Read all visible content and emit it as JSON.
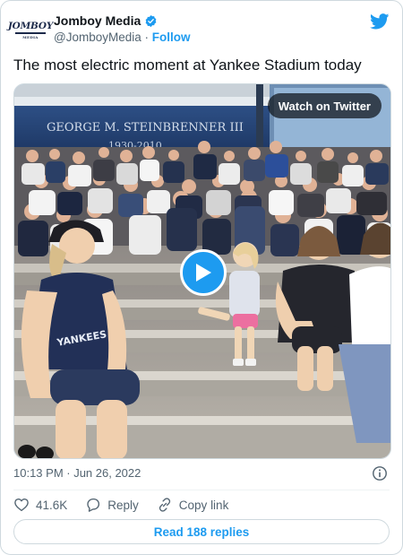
{
  "author": {
    "display_name": "Jomboy Media",
    "handle": "@JomboyMedia",
    "separator": " · ",
    "follow_label": "Follow",
    "logo_text": "JOMBOY",
    "logo_subtext": "MEDIA",
    "verified_icon": "verified-badge-icon"
  },
  "tweet": {
    "text": "The most electric moment at Yankee Stadium today",
    "timestamp": "10:13 PM · Jun 26, 2022"
  },
  "media": {
    "type": "video",
    "watch_label": "Watch on Twitter",
    "stadium_sign": "GEORGE M. STEINBRENNER III",
    "stadium_sign_sub": "1930-2010",
    "shirt_text": "YANKEES",
    "play_icon": "play-icon"
  },
  "actions": {
    "like_count": "41.6K",
    "reply_label": "Reply",
    "copy_link_label": "Copy link"
  },
  "replies_button": "Read 188 replies",
  "colors": {
    "accent": "#1d9bf0",
    "text": "#0f1419",
    "muted": "#536471",
    "border": "#cfd9de"
  }
}
